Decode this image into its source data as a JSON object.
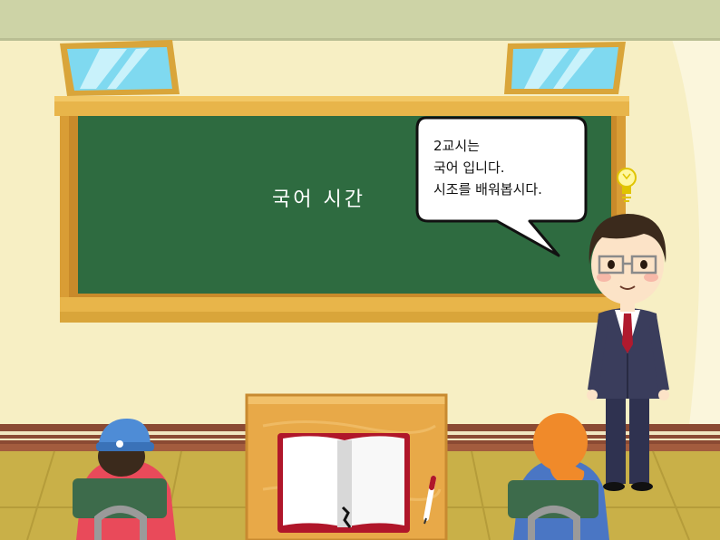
{
  "blackboard": {
    "title": "국어 시간"
  },
  "speech_bubble": {
    "lines": [
      "2교시는",
      "국어 입니다.",
      "시조를 배워봅시다."
    ]
  },
  "icons": [
    "lightbulb-icon",
    "pencil-icon"
  ],
  "colors": {
    "wall": "#f7efc4",
    "ceiling": "#cdd3a6",
    "blackboard": "#2e6b40",
    "board_frame": "#e8b54a",
    "floor": "#c9b048",
    "wainscot": "#8b4a33",
    "teacher_suit": "#3a3d5c",
    "tie": "#b01a2e"
  }
}
